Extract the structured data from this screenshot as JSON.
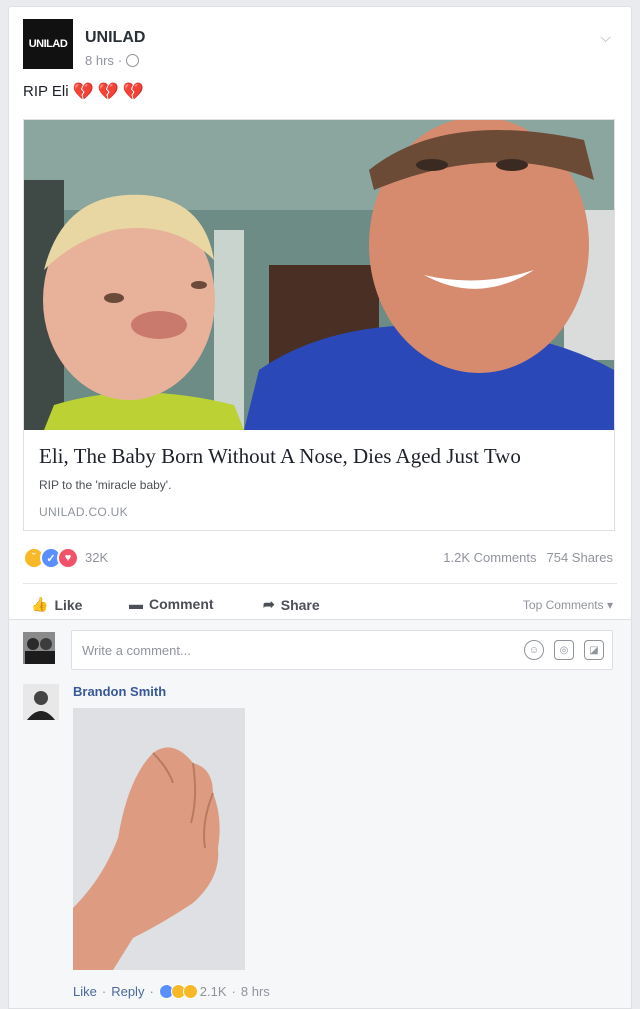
{
  "post": {
    "page_logo": "UNILAD",
    "page_name": "UNILAD",
    "time": "8 hrs",
    "privacy_icon": "globe-icon",
    "menu_icon": "chevron-down-icon",
    "text": "RIP Eli",
    "heart_icon": "broken-heart-icon"
  },
  "link_preview": {
    "title": "Eli, The Baby Born Without A Nose, Dies Aged Just Two",
    "description": "RIP to the 'miracle baby'.",
    "domain": "UNILAD.CO.UK"
  },
  "reactions": {
    "count": "32K",
    "comments": "1.2K Comments",
    "shares": "754 Shares"
  },
  "actions": {
    "like": "Like",
    "comment": "Comment",
    "share": "Share",
    "top_comments": "Top Comments"
  },
  "comment_input": {
    "placeholder": "Write a comment..."
  },
  "comment": {
    "author": "Brandon Smith",
    "like": "Like",
    "reply": "Reply",
    "reaction_count": "2.1K",
    "time": "8 hrs"
  },
  "colors": {
    "link_blue": "#365899",
    "meta_grey": "#90949c",
    "love_red": "#f25268",
    "like_blue": "#5890ff",
    "sad_yellow": "#f7b928"
  }
}
